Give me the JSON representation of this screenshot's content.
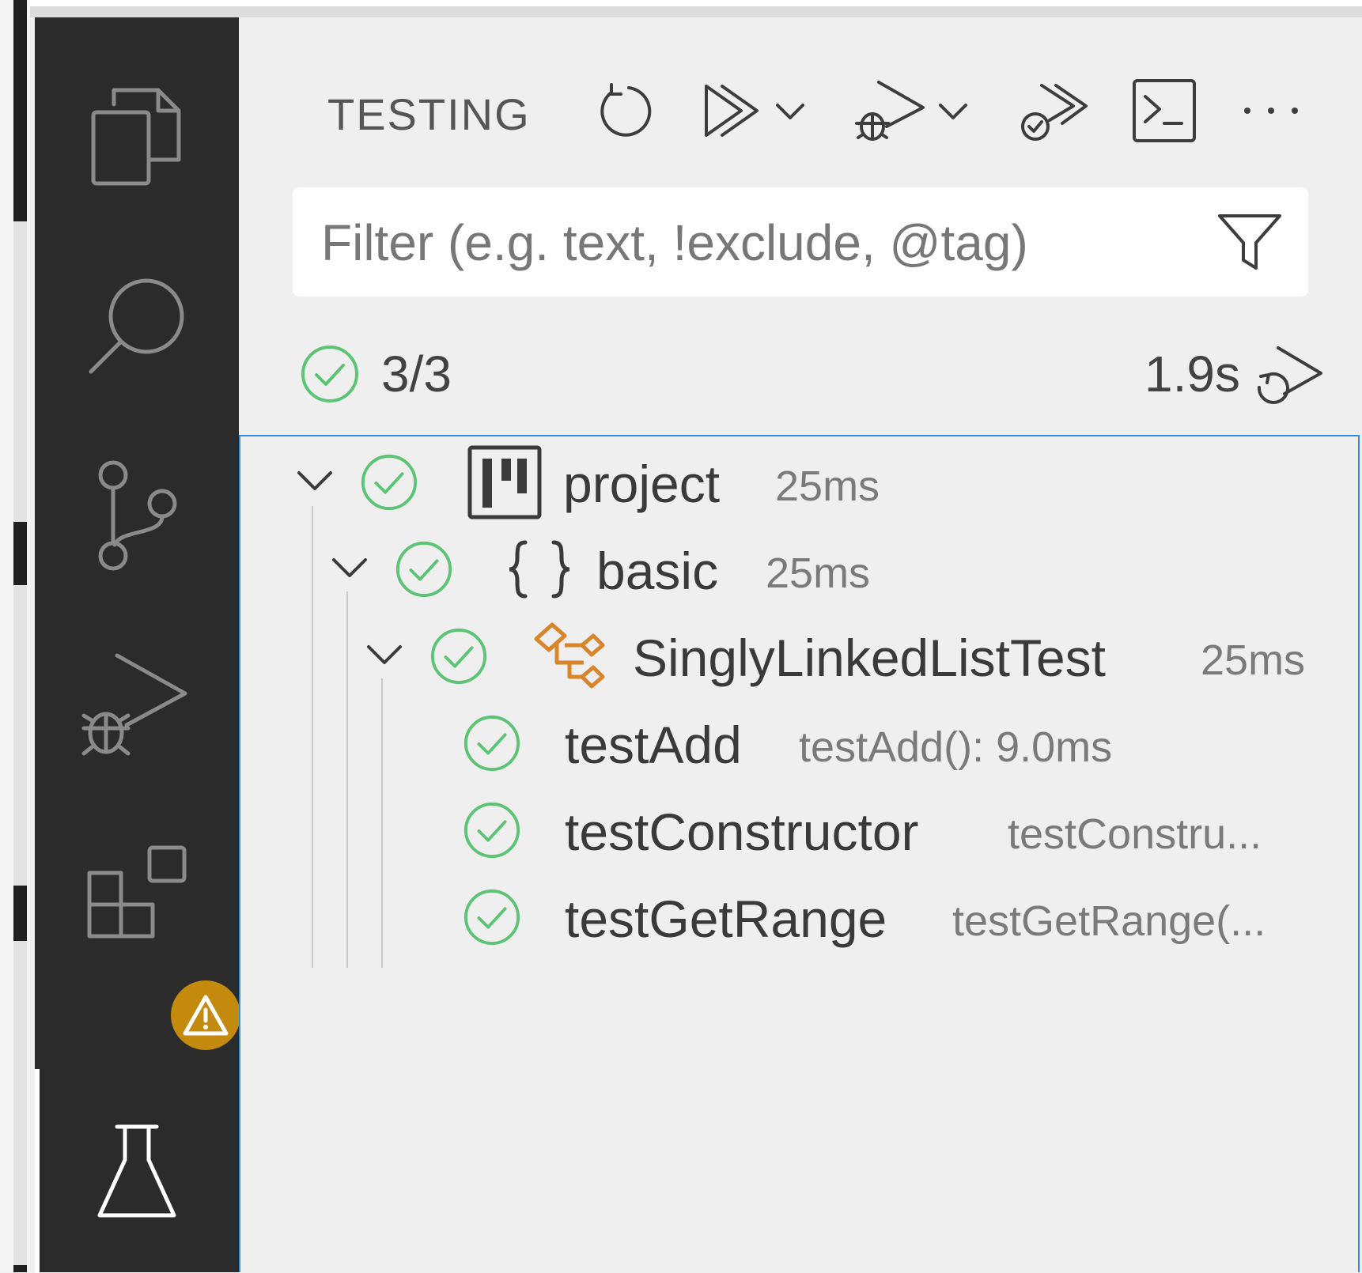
{
  "panel": {
    "title": "TESTING",
    "filter_placeholder": "Filter (e.g. text, !exclude, @tag)"
  },
  "toolbar": {
    "icons": [
      "refresh-icon",
      "run-all-icon",
      "run-dropdown-icon",
      "debug-all-icon",
      "debug-dropdown-icon",
      "continuous-run-icon",
      "terminal-icon",
      "more-icon"
    ]
  },
  "summary": {
    "count": "3/3",
    "duration": "1.9s"
  },
  "colors": {
    "pass": "#5cc474",
    "class_icon": "#d9862b",
    "warning_badge": "#c48a0e",
    "focus_border": "#2f8ee0",
    "activity_bar": "#2b2b2b"
  },
  "tree": {
    "project": {
      "label": "project",
      "desc": "25ms"
    },
    "package": {
      "label": "basic",
      "desc": "25ms"
    },
    "klass": {
      "label": "SinglyLinkedListTest",
      "desc": "25ms"
    },
    "tests": [
      {
        "label": "testAdd",
        "desc": "testAdd(): 9.0ms"
      },
      {
        "label": "testConstructor",
        "desc": "testConstru..."
      },
      {
        "label": "testGetRange",
        "desc": "testGetRange(..."
      }
    ]
  }
}
